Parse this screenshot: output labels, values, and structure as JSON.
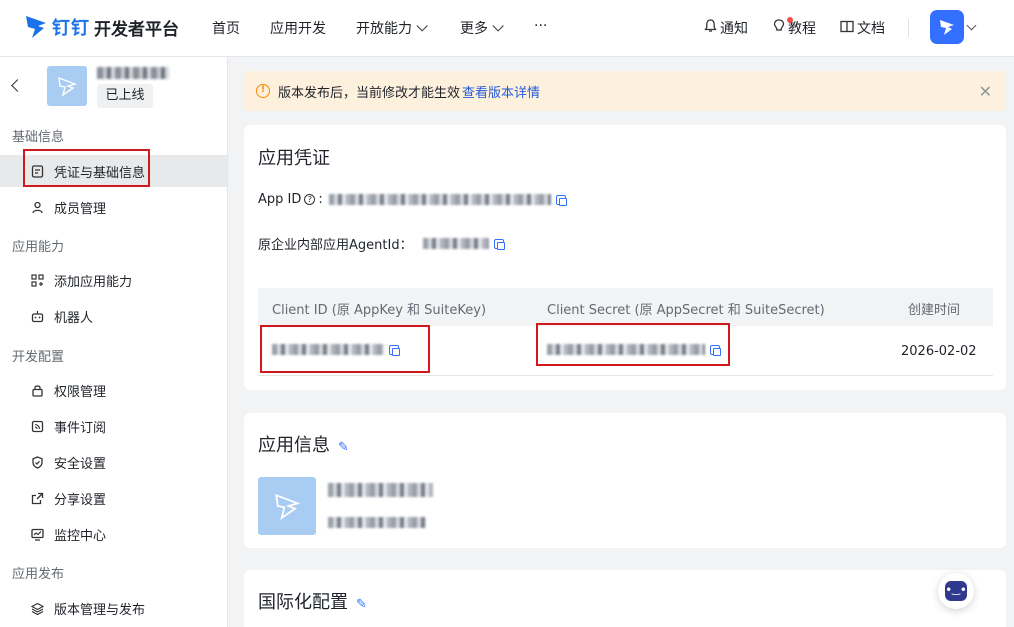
{
  "topnav": {
    "logo_text": "钉钉",
    "logo_sub": "开发者平台",
    "items": [
      {
        "label": "首页"
      },
      {
        "label": "应用开发"
      },
      {
        "label": "开放能力"
      },
      {
        "label": "更多"
      },
      {
        "label": "···"
      }
    ],
    "right": {
      "notify": "通知",
      "tutorial": "教程",
      "docs": "文档"
    }
  },
  "sidebar": {
    "app_status": "已上线",
    "groups": [
      {
        "title": "基础信息",
        "items": [
          {
            "label": "凭证与基础信息"
          },
          {
            "label": "成员管理"
          }
        ]
      },
      {
        "title": "应用能力",
        "items": [
          {
            "label": "添加应用能力"
          },
          {
            "label": "机器人"
          }
        ]
      },
      {
        "title": "开发配置",
        "items": [
          {
            "label": "权限管理"
          },
          {
            "label": "事件订阅"
          },
          {
            "label": "安全设置"
          },
          {
            "label": "分享设置"
          },
          {
            "label": "监控中心"
          }
        ]
      },
      {
        "title": "应用发布",
        "items": [
          {
            "label": "版本管理与发布"
          }
        ]
      }
    ]
  },
  "notice": {
    "text": "版本发布后，当前修改才能生效",
    "link": "查看版本详情",
    "close": "✕"
  },
  "credentials": {
    "title": "应用凭证",
    "app_id_label": "App ID",
    "agent_id_label": "原企业内部应用AgentId：",
    "table": {
      "headers": [
        "Client ID (原 AppKey 和 SuiteKey)",
        "Client Secret (原 AppSecret 和 SuiteSecret)",
        "创建时间"
      ],
      "row": {
        "created": "2026-02-02"
      }
    }
  },
  "app_info": {
    "title": "应用信息"
  },
  "i18n": {
    "title": "国际化配置"
  },
  "colors": {
    "accent": "#3370ff",
    "highlight_box": "#d0191d",
    "notice_bg": "#fdf0dd"
  }
}
